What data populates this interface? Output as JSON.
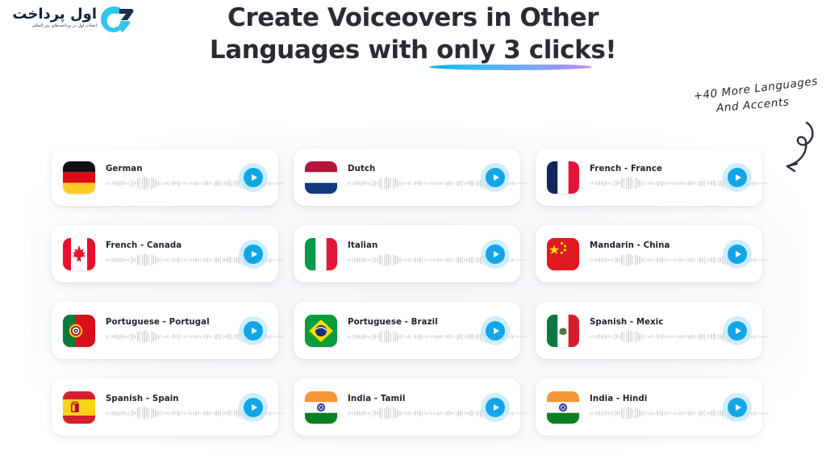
{
  "logo": {
    "name": "اول پرداخت",
    "tagline": "انتخاب اول در پرداخت‌های بین المللی",
    "mark_icon": "ap-monogram-icon",
    "colors": {
      "mark": "#29c3f0",
      "mark_dark": "#1b2a4e",
      "text": "#17213a"
    }
  },
  "headline": {
    "line1": "Create Voiceovers in Other",
    "line2": "Languages with only 3 clicks!",
    "underline_gradient_from": "#00b4f0",
    "underline_gradient_to": "#b98cf0"
  },
  "annotation": {
    "line1": "+40 More Languages",
    "line2": "And Accents",
    "arrow_icon": "curved-arrow-icon"
  },
  "theme": {
    "play_button": "#12a6e8",
    "play_halo": "#bfe8fb",
    "waveform": "#d8dade",
    "card_bg": "#ffffff",
    "page_bg": "#ffffff",
    "heading_text": "#2b2b33",
    "card_text": "#21242c"
  },
  "cards": [
    {
      "language": "German",
      "flag": "flag-germany",
      "play_label": "Play German sample"
    },
    {
      "language": "Dutch",
      "flag": "flag-netherlands",
      "play_label": "Play Dutch sample"
    },
    {
      "language": "French - France",
      "flag": "flag-france",
      "play_label": "Play French - France sample"
    },
    {
      "language": "French - Canada",
      "flag": "flag-canada",
      "play_label": "Play French - Canada sample"
    },
    {
      "language": "Italian",
      "flag": "flag-italy",
      "play_label": "Play Italian sample"
    },
    {
      "language": "Mandarin - China",
      "flag": "flag-china",
      "play_label": "Play Mandarin - China sample"
    },
    {
      "language": "Portuguese - Portugal",
      "flag": "flag-portugal",
      "play_label": "Play Portuguese - Portugal sample"
    },
    {
      "language": "Portuguese - Brazil",
      "flag": "flag-brazil",
      "play_label": "Play Portuguese - Brazil sample"
    },
    {
      "language": "Spanish - Mexic",
      "flag": "flag-mexico",
      "play_label": "Play Spanish - Mexic sample"
    },
    {
      "language": "Spanish - Spain",
      "flag": "flag-spain",
      "play_label": "Play Spanish - Spain sample"
    },
    {
      "language": "India - Tamil",
      "flag": "flag-india",
      "play_label": "Play India - Tamil sample"
    },
    {
      "language": "India - Hindi",
      "flag": "flag-india",
      "play_label": "Play India - Hindi sample"
    }
  ],
  "waveform_bars": [
    3,
    4,
    5,
    4,
    6,
    5,
    7,
    6,
    4,
    3,
    5,
    9,
    6,
    4,
    12,
    15,
    13,
    16,
    14,
    11,
    15,
    12,
    9,
    5,
    6,
    4,
    3,
    4,
    5,
    3,
    6,
    4,
    7,
    5,
    4,
    3,
    2,
    3,
    4,
    3,
    5,
    4,
    3,
    4,
    5,
    6,
    4,
    3,
    5,
    7,
    6,
    9,
    5,
    4,
    6,
    8,
    5,
    7,
    6,
    9,
    13,
    15,
    12,
    16,
    14,
    11,
    9,
    6,
    5,
    7,
    4,
    6,
    3,
    5,
    4,
    3,
    2,
    3,
    2,
    3
  ]
}
